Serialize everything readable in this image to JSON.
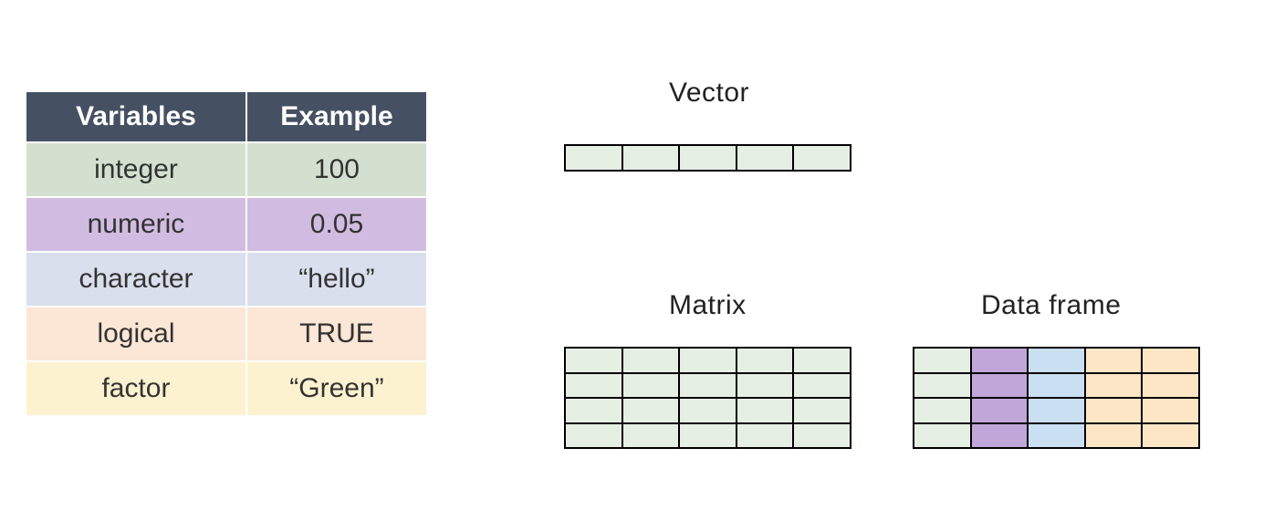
{
  "table": {
    "headers": [
      "Variables",
      "Example"
    ],
    "rows": [
      {
        "type": "integer",
        "example": "100"
      },
      {
        "type": "numeric",
        "example": "0.05"
      },
      {
        "type": "character",
        "example": "“hello”"
      },
      {
        "type": "logical",
        "example": "TRUE"
      },
      {
        "type": "factor",
        "example": "“Green”"
      }
    ]
  },
  "structures": {
    "vector": {
      "title": "Vector",
      "rows": 1,
      "cols": 5,
      "cell_colors": [
        [
          "green",
          "green",
          "green",
          "green",
          "green"
        ]
      ]
    },
    "matrix": {
      "title": "Matrix",
      "rows": 4,
      "cols": 5,
      "cell_colors": [
        [
          "green",
          "green",
          "green",
          "green",
          "green"
        ],
        [
          "green",
          "green",
          "green",
          "green",
          "green"
        ],
        [
          "green",
          "green",
          "green",
          "green",
          "green"
        ],
        [
          "green",
          "green",
          "green",
          "green",
          "green"
        ]
      ]
    },
    "dataframe": {
      "title": "Data frame",
      "rows": 4,
      "cols": 5,
      "cell_colors": [
        [
          "green",
          "purple",
          "blue",
          "orange",
          "orange"
        ],
        [
          "green",
          "purple",
          "blue",
          "orange",
          "orange"
        ],
        [
          "green",
          "purple",
          "blue",
          "orange",
          "orange"
        ],
        [
          "green",
          "purple",
          "blue",
          "orange",
          "orange"
        ]
      ]
    }
  },
  "colors": {
    "green": "#e6efe3",
    "purple": "#c1a6da",
    "blue": "#cadff2",
    "orange": "#fde6c6"
  }
}
